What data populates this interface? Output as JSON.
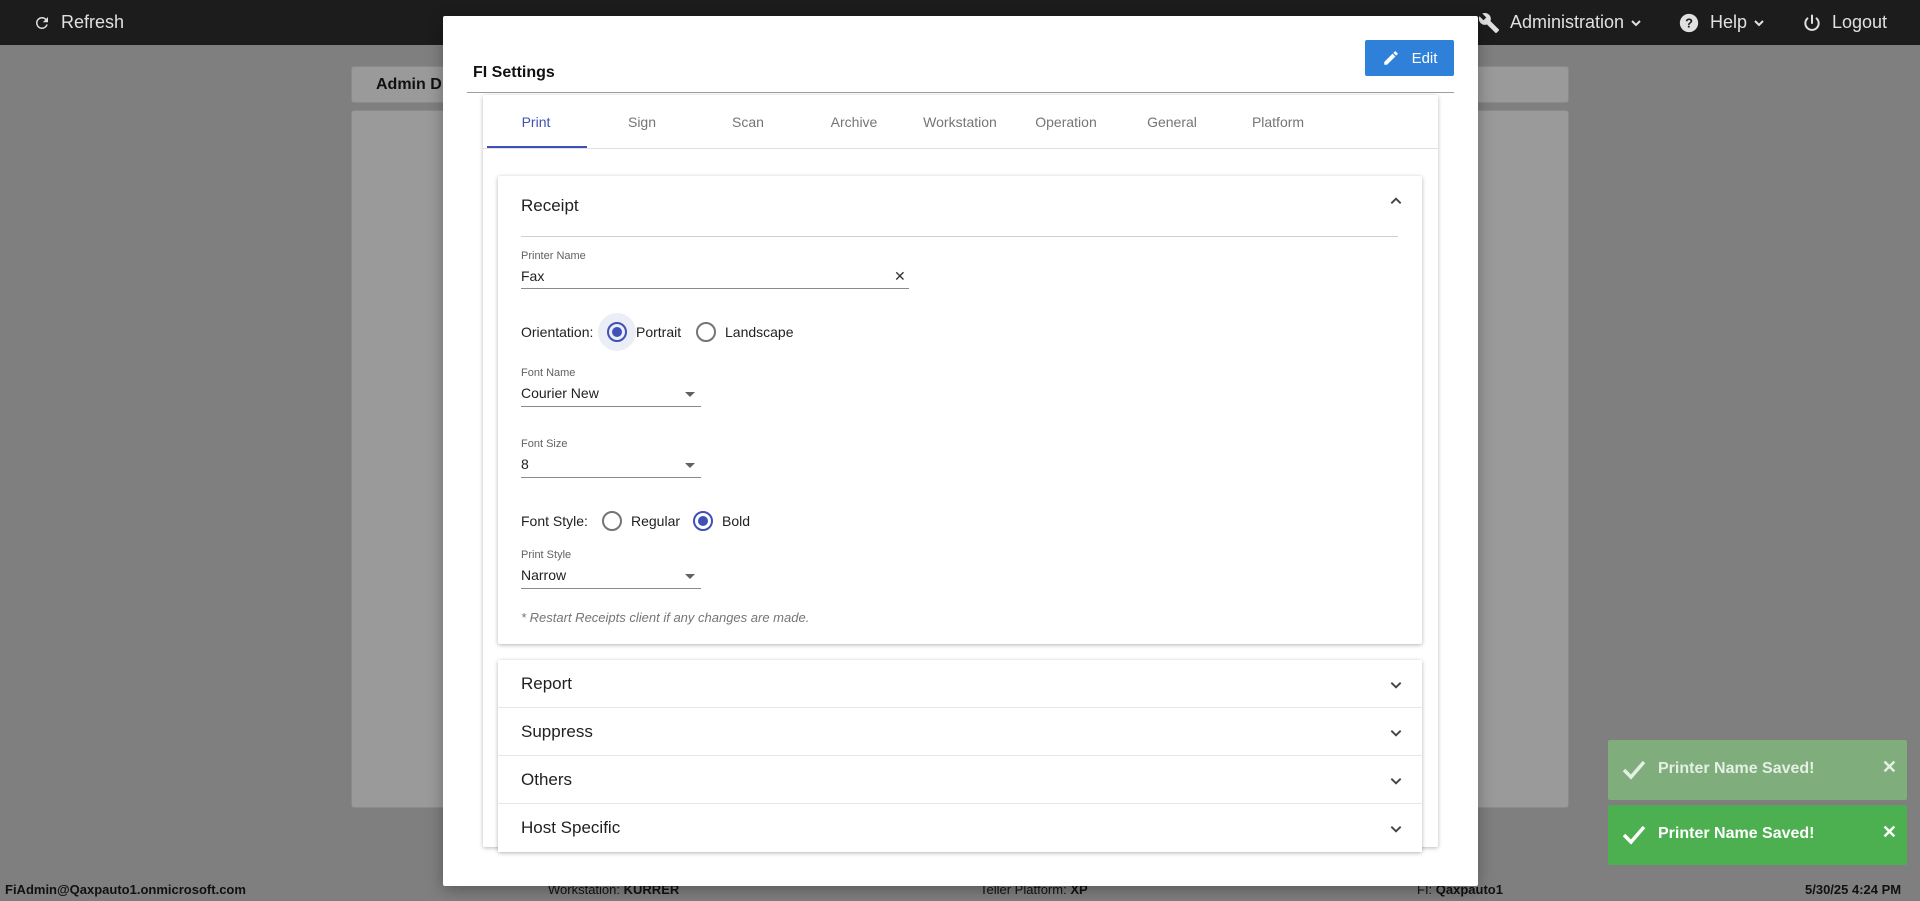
{
  "topbar": {
    "refresh_label": "Refresh",
    "administration_label": "Administration",
    "help_label": "Help",
    "logout_label": "Logout"
  },
  "background": {
    "header_text": "Admin D"
  },
  "modal": {
    "title": "FI Settings",
    "edit_label": "Edit",
    "tabs": [
      {
        "label": "Print"
      },
      {
        "label": "Sign"
      },
      {
        "label": "Scan"
      },
      {
        "label": "Archive"
      },
      {
        "label": "Workstation"
      },
      {
        "label": "Operation"
      },
      {
        "label": "General"
      },
      {
        "label": "Platform"
      }
    ],
    "active_tab": "Print",
    "receipt": {
      "title": "Receipt",
      "printer_name": {
        "label": "Printer Name",
        "value": "Fax",
        "clear": "✕"
      },
      "orientation": {
        "label": "Orientation:",
        "options": [
          "Portrait",
          "Landscape"
        ],
        "selected": "Portrait"
      },
      "font_name": {
        "label": "Font Name",
        "value": "Courier New"
      },
      "font_size": {
        "label": "Font Size",
        "value": "8"
      },
      "font_style": {
        "label": "Font Style:",
        "options": [
          "Regular",
          "Bold"
        ],
        "selected": "Bold"
      },
      "print_style": {
        "label": "Print Style",
        "value": "Narrow"
      },
      "note": "* Restart Receipts client if any changes are made."
    },
    "sections": [
      {
        "title": "Report"
      },
      {
        "title": "Suppress"
      },
      {
        "title": "Others"
      },
      {
        "title": "Host Specific"
      }
    ]
  },
  "toasts": [
    {
      "text": "Printer Name Saved!",
      "close": "✕"
    },
    {
      "text": "Printer Name Saved!",
      "close": "✕"
    }
  ],
  "footer": {
    "user": "FiAdmin@Qaxpauto1.onmicrosoft.com",
    "workstation_label": "Workstation:",
    "workstation_value": "KURRER",
    "platform_label": "Teller Platform:",
    "platform_value": "XP",
    "fi_label": "FI:",
    "fi_value": "Qaxpauto1",
    "datetime": "5/30/25 4:24 PM"
  },
  "colors": {
    "accent": "#3f51b5",
    "edit_button": "#2f80d8",
    "toast_success": "#4caf50",
    "toast_success_faded": "#7fae7c"
  }
}
